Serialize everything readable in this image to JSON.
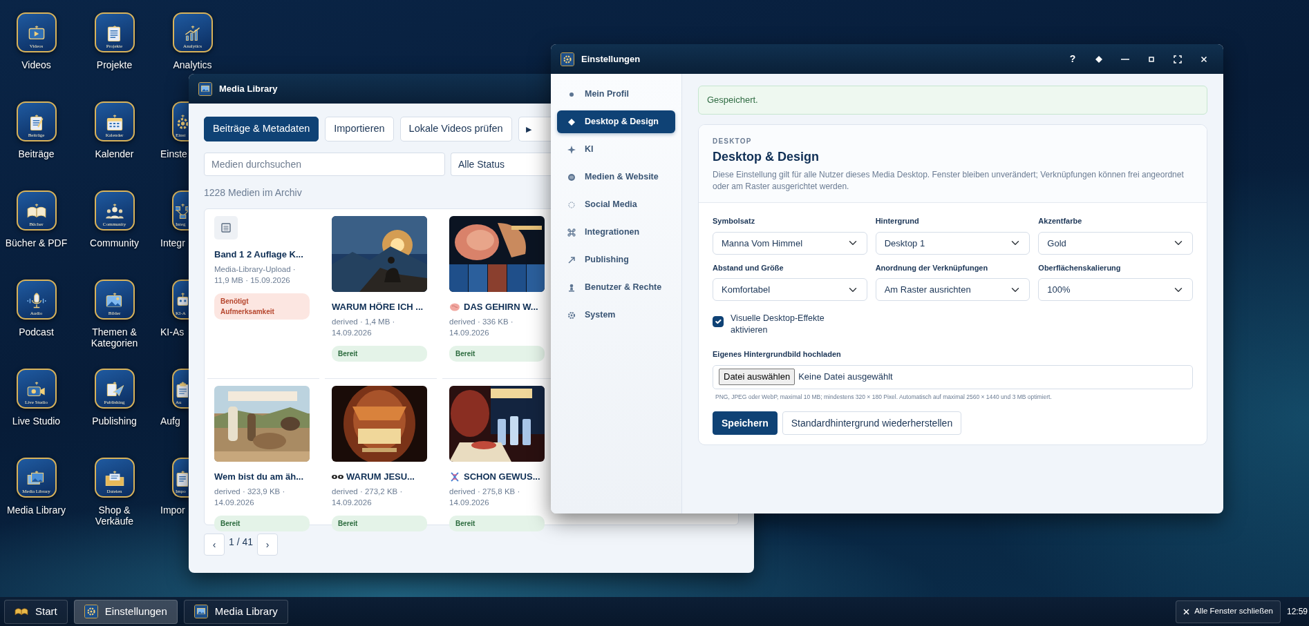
{
  "desktop_icons": [
    {
      "label": "Videos",
      "caption": "Videos"
    },
    {
      "label": "Projekte",
      "caption": "Projekte"
    },
    {
      "label": "Analytics",
      "caption": "Analytics"
    },
    {
      "label": "Beiträge",
      "caption": "Beiträge"
    },
    {
      "label": "Kalender",
      "caption": "Kalender"
    },
    {
      "label": "Einste",
      "caption": "Einst"
    },
    {
      "label": "Bücher & PDF",
      "caption": "Bücher"
    },
    {
      "label": "Community",
      "caption": "Community"
    },
    {
      "label": "Integr",
      "caption": "Integ"
    },
    {
      "label": "Podcast",
      "caption": "Audio"
    },
    {
      "label": "Themen & Kategorien",
      "caption": "Bilder"
    },
    {
      "label": "KI-As",
      "caption": "KI-A"
    },
    {
      "label": "Live Studio",
      "caption": "Live Studio"
    },
    {
      "label": "Publishing",
      "caption": "Publishing"
    },
    {
      "label": "Aufg",
      "caption": "Au"
    },
    {
      "label": "Media Library",
      "caption": "Media Library"
    },
    {
      "label": "Shop & Verkäufe",
      "caption": "Dateien"
    },
    {
      "label": "Impor",
      "caption": "Impo"
    }
  ],
  "media_window": {
    "title": "Media Library",
    "tabs": [
      {
        "label": "Beiträge & Metadaten",
        "selected": true
      },
      {
        "label": "Importieren",
        "selected": false
      },
      {
        "label": "Lokale Videos prüfen",
        "selected": false
      },
      {
        "label": "▶",
        "selected": false
      }
    ],
    "search": {
      "placeholder": "Medien durchsuchen"
    },
    "filter": {
      "value": "Alle Status"
    },
    "count": "1228 Medien im Archiv",
    "items": [
      {
        "kind": "document",
        "title": "Band 1 2 Auflage K...",
        "meta": "Media-Library-Upload · 11,9 MB · 15.09.2026",
        "status": "Benötigt Aufmerksamkeit",
        "needs_attention": true,
        "title_icon": false
      },
      {
        "kind": "picture",
        "title": "WARUM HÖRE ICH ...",
        "meta": "derived · 1,4 MB · 14.09.2026",
        "status": "Bereit",
        "needs_attention": false,
        "title_icon": false
      },
      {
        "kind": "picture",
        "title": "DAS GEHIRN W...",
        "meta": "derived · 336 KB · 14.09.2026",
        "status": "Bereit",
        "needs_attention": false,
        "title_icon": true
      },
      {
        "kind": "picture",
        "title": "Wem bist du am äh...",
        "meta": "derived · 323,9 KB · 14.09.2026",
        "status": "Bereit",
        "needs_attention": false,
        "title_icon": false
      },
      {
        "kind": "picture",
        "title": "WARUM JESU...",
        "meta": "derived · 273,2 KB · 14.09.2026",
        "status": "Bereit",
        "needs_attention": false,
        "title_icon": true
      },
      {
        "kind": "picture",
        "title": "SCHON GEWUS...",
        "meta": "derived · 275,8 KB · 14.09.2026",
        "status": "Bereit",
        "needs_attention": false,
        "title_icon": true
      }
    ],
    "pagination": {
      "prev": "‹",
      "page": "1 / 41",
      "next": "›"
    }
  },
  "settings_window": {
    "title": "Einstellungen",
    "help": "?",
    "nav": [
      {
        "label": "Mein Profil",
        "selected": false
      },
      {
        "label": "Desktop & Design",
        "selected": true
      },
      {
        "label": "KI",
        "selected": false
      },
      {
        "label": "Medien & Website",
        "selected": false
      },
      {
        "label": "Social Media",
        "selected": false
      },
      {
        "label": "Integrationen",
        "selected": false
      },
      {
        "label": "Publishing",
        "selected": false
      },
      {
        "label": "Benutzer & Rechte",
        "selected": false
      },
      {
        "label": "System",
        "selected": false
      }
    ],
    "alert": "Gespeichert.",
    "section": {
      "eyebrow": "DESKTOP",
      "heading": "Desktop & Design",
      "description": "Diese Einstellung gilt für alle Nutzer dieses Media Desktop. Fenster bleiben unverändert; Verknüpfungen können frei angeordnet oder am Raster ausgerichtet werden."
    },
    "fields": [
      {
        "label": "Symbolsatz",
        "value": "Manna Vom Himmel"
      },
      {
        "label": "Hintergrund",
        "value": "Desktop 1"
      },
      {
        "label": "Akzentfarbe",
        "value": "Gold"
      },
      {
        "label": "Abstand und Größe",
        "value": "Komfortabel"
      },
      {
        "label": "Anordnung der Verknüpfungen",
        "value": "Am Raster ausrichten"
      },
      {
        "label": "Oberflächenskalierung",
        "value": "100%"
      }
    ],
    "checkbox": {
      "label": "Visuelle Desktop-Effekte aktivieren",
      "checked": true
    },
    "upload": {
      "label": "Eigenes Hintergrundbild hochladen",
      "button": "Datei auswählen",
      "value": "Keine Datei ausgewählt",
      "help": "PNG, JPEG oder WebP, maximal 10 MB; mindestens 320 × 180 Pixel. Automatisch auf maximal 2560 × 1440 und 3 MB optimiert."
    },
    "buttons": [
      {
        "label": "Speichern",
        "primary": true
      },
      {
        "label": "Standardhintergrund wiederherstellen",
        "primary": false
      }
    ]
  },
  "taskbar": {
    "start": "Start",
    "windows": [
      {
        "label": "Einstellungen",
        "selected": true
      },
      {
        "label": "Media Library",
        "selected": false
      }
    ],
    "close_all": "Alle Fenster schließen",
    "clock": "12:59"
  }
}
